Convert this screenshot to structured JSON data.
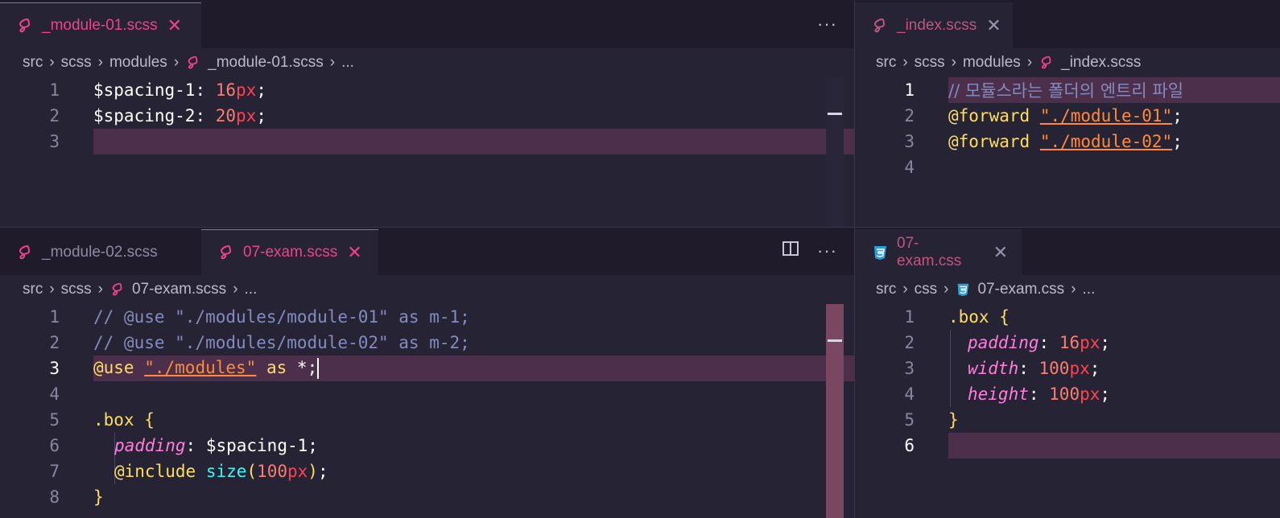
{
  "colors": {
    "accent": "#f0418d",
    "background": "#262335",
    "tabbar": "#1f1b2b",
    "line_highlight": "#4c2f4a"
  },
  "top_left": {
    "tabs": [
      {
        "label": "_module-01.scss",
        "icon": "sass-icon",
        "active": true
      }
    ],
    "actions": {
      "more": "···"
    },
    "breadcrumb": {
      "p1": "src",
      "p2": "scss",
      "p3": "modules",
      "file": "_module-01.scss",
      "more": "..."
    },
    "lines": [
      {
        "n": "1",
        "var": "$spacing-1",
        "colon": ": ",
        "num": "16",
        "unit": "px",
        "end": ";"
      },
      {
        "n": "2",
        "var": "$spacing-2",
        "colon": ": ",
        "num": "20",
        "unit": "px",
        "end": ";"
      },
      {
        "n": "3"
      }
    ]
  },
  "top_right": {
    "tabs": [
      {
        "label": "_index.scss",
        "icon": "sass-icon",
        "active": false
      }
    ],
    "breadcrumb": {
      "p1": "src",
      "p2": "scss",
      "p3": "modules",
      "file": "_index.scss"
    },
    "lines": [
      {
        "n": "1",
        "comment": "// 모듈스라는 폴더의 엔트리 파일"
      },
      {
        "n": "2",
        "at": "@forward",
        "str": "\"./module-01\"",
        "end": ";"
      },
      {
        "n": "3",
        "at": "@forward",
        "str": "\"./module-02\"",
        "end": ";"
      },
      {
        "n": "4"
      }
    ]
  },
  "bottom_left": {
    "tabs": [
      {
        "label": "_module-02.scss",
        "icon": "sass-icon",
        "active": false
      },
      {
        "label": "07-exam.scss",
        "icon": "sass-icon",
        "active": true
      }
    ],
    "actions": {
      "split": "split-editor-icon",
      "more": "···"
    },
    "breadcrumb": {
      "p1": "src",
      "p2": "scss",
      "file": "07-exam.scss",
      "more": "..."
    },
    "lines": [
      {
        "n": "1",
        "comment": "// @use \"./modules/module-01\" as m-1;"
      },
      {
        "n": "2",
        "comment": "// @use \"./modules/module-02\" as m-2;"
      },
      {
        "n": "3",
        "at": "@use",
        "str": "\"./modules\"",
        "as": "as",
        "rest": "*;"
      },
      {
        "n": "4"
      },
      {
        "n": "5",
        "sel": ".box",
        "brace": "{"
      },
      {
        "n": "6",
        "prop": "padding",
        "colon": ": ",
        "val": "$spacing-1",
        "end": ";"
      },
      {
        "n": "7",
        "at": "@include",
        "fn": "size",
        "arg_num": "100",
        "arg_unit": "px",
        "end": ";"
      },
      {
        "n": "8",
        "brace": "}"
      }
    ]
  },
  "bottom_right": {
    "tabs": [
      {
        "label": "07-exam.css",
        "icon": "css-icon",
        "active": false
      }
    ],
    "breadcrumb": {
      "p1": "src",
      "p2": "css",
      "file": "07-exam.css",
      "more": "..."
    },
    "lines": [
      {
        "n": "1",
        "sel": ".box",
        "brace": "{"
      },
      {
        "n": "2",
        "prop": "padding",
        "colon": ": ",
        "num": "16",
        "unit": "px",
        "end": ";"
      },
      {
        "n": "3",
        "prop": "width",
        "colon": ": ",
        "num": "100",
        "unit": "px",
        "end": ";"
      },
      {
        "n": "4",
        "prop": "height",
        "colon": ": ",
        "num": "100",
        "unit": "px",
        "end": ";"
      },
      {
        "n": "5",
        "brace": "}"
      },
      {
        "n": "6"
      }
    ]
  }
}
